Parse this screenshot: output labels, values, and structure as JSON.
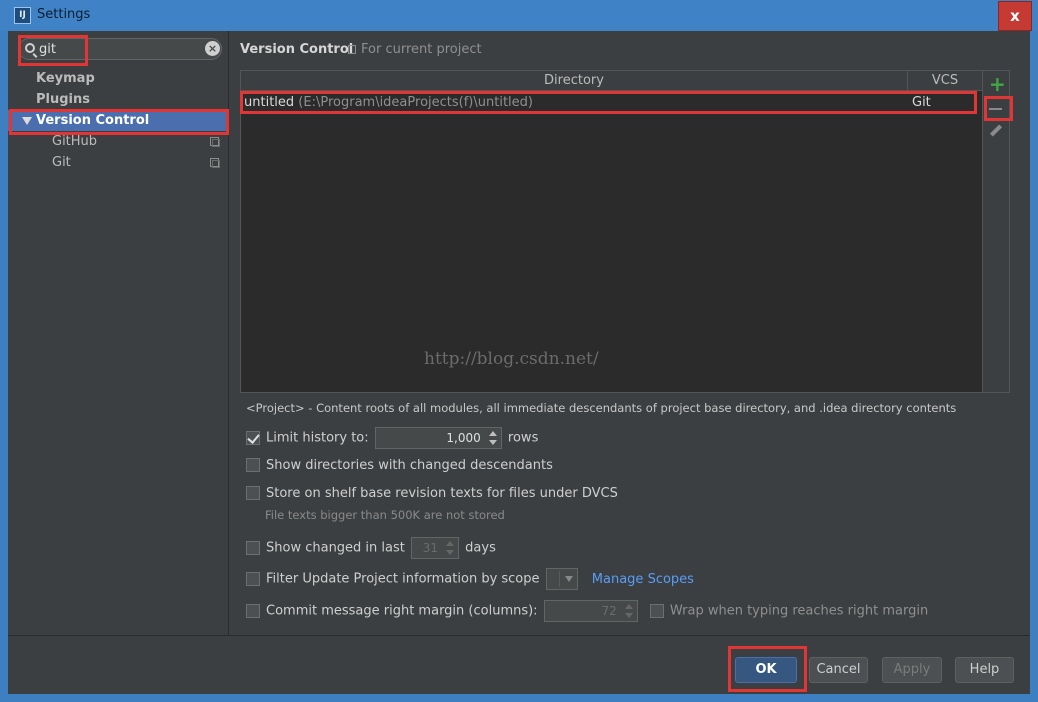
{
  "window": {
    "app_icon": "intellij-idea-icon",
    "app_icon_glyph": "IJ",
    "title": "Settings",
    "close_label": "x"
  },
  "sidebar": {
    "search": {
      "value": "git",
      "placeholder": ""
    },
    "items": [
      {
        "label": "Keymap"
      },
      {
        "label": "Plugins"
      },
      {
        "label": "Version Control",
        "selected": true,
        "expanded": true
      },
      {
        "label": "GitHub"
      },
      {
        "label": "Git"
      }
    ]
  },
  "main": {
    "title": "Version Control",
    "scope_note": "For current project",
    "table": {
      "columns": [
        "Directory",
        "VCS"
      ],
      "rows": [
        {
          "name": "untitled",
          "path": "(E:\\Program\\ideaProjects(f)\\untitled)",
          "vcs": "Git"
        }
      ]
    },
    "watermark": "http://blog.csdn.net/",
    "project_note": "<Project> - Content roots of all modules, all immediate descendants of project base directory, and .idea directory contents",
    "options": {
      "limit_history": {
        "label": "Limit history to:",
        "value": "1,000",
        "suffix": "rows",
        "checked": true
      },
      "show_dirs": {
        "label": "Show directories with changed descendants",
        "checked": false
      },
      "store_shelf": {
        "label": "Store on shelf base revision texts for files under DVCS",
        "checked": false,
        "note": "File texts bigger than 500K are not stored"
      },
      "show_changed": {
        "label": "Show changed in last",
        "value": "31",
        "suffix": "days",
        "checked": false
      },
      "filter_update": {
        "label": "Filter Update Project information by scope",
        "link": "Manage Scopes",
        "checked": false
      },
      "commit_margin": {
        "label": "Commit message right margin (columns):",
        "value": "72",
        "checked": false
      },
      "wrap_typing": {
        "label": "Wrap when typing reaches right margin",
        "checked": false
      }
    }
  },
  "footer": {
    "ok": "OK",
    "cancel": "Cancel",
    "apply": "Apply",
    "help": "Help"
  },
  "colors": {
    "highlight": "#e23636",
    "selection": "#4b6eaf",
    "add_green": "#3fa845",
    "link": "#589df6"
  }
}
